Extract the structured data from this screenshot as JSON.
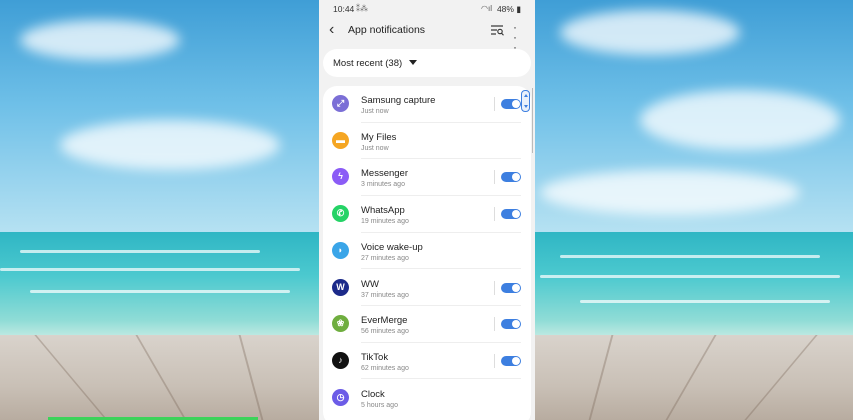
{
  "status_bar": {
    "time": "10:44",
    "battery": "48%"
  },
  "header": {
    "title": "App notifications"
  },
  "sort": {
    "label": "Most recent (38)"
  },
  "apps": [
    {
      "name": "Samsung capture",
      "time": "Just now",
      "icon": "samsung-capture-icon",
      "color": "#7b6fd6",
      "glyph": "⤢",
      "toggle": true
    },
    {
      "name": "My Files",
      "time": "Just now",
      "icon": "folder-icon",
      "color": "#f5a623",
      "glyph": "▬",
      "toggle": false
    },
    {
      "name": "Messenger",
      "time": "3 minutes ago",
      "icon": "messenger-icon",
      "color": "#8b5cf6",
      "glyph": "ϟ",
      "toggle": true
    },
    {
      "name": "WhatsApp",
      "time": "19 minutes ago",
      "icon": "whatsapp-icon",
      "color": "#25d366",
      "glyph": "✆",
      "toggle": true
    },
    {
      "name": "Voice wake-up",
      "time": "27 minutes ago",
      "icon": "voice-wakeup-icon",
      "color": "#3aa5e8",
      "glyph": "◗",
      "toggle": false
    },
    {
      "name": "WW",
      "time": "37 minutes ago",
      "icon": "ww-icon",
      "color": "#1c2a8a",
      "glyph": "W",
      "toggle": true
    },
    {
      "name": "EverMerge",
      "time": "56 minutes ago",
      "icon": "evermerge-icon",
      "color": "#6fae3f",
      "glyph": "❀",
      "toggle": true
    },
    {
      "name": "TikTok",
      "time": "62 minutes ago",
      "icon": "tiktok-icon",
      "color": "#111111",
      "glyph": "♪",
      "toggle": true
    },
    {
      "name": "Clock",
      "time": "5 hours ago",
      "icon": "clock-icon",
      "color": "#6c5ce7",
      "glyph": "◷",
      "toggle": false
    }
  ]
}
